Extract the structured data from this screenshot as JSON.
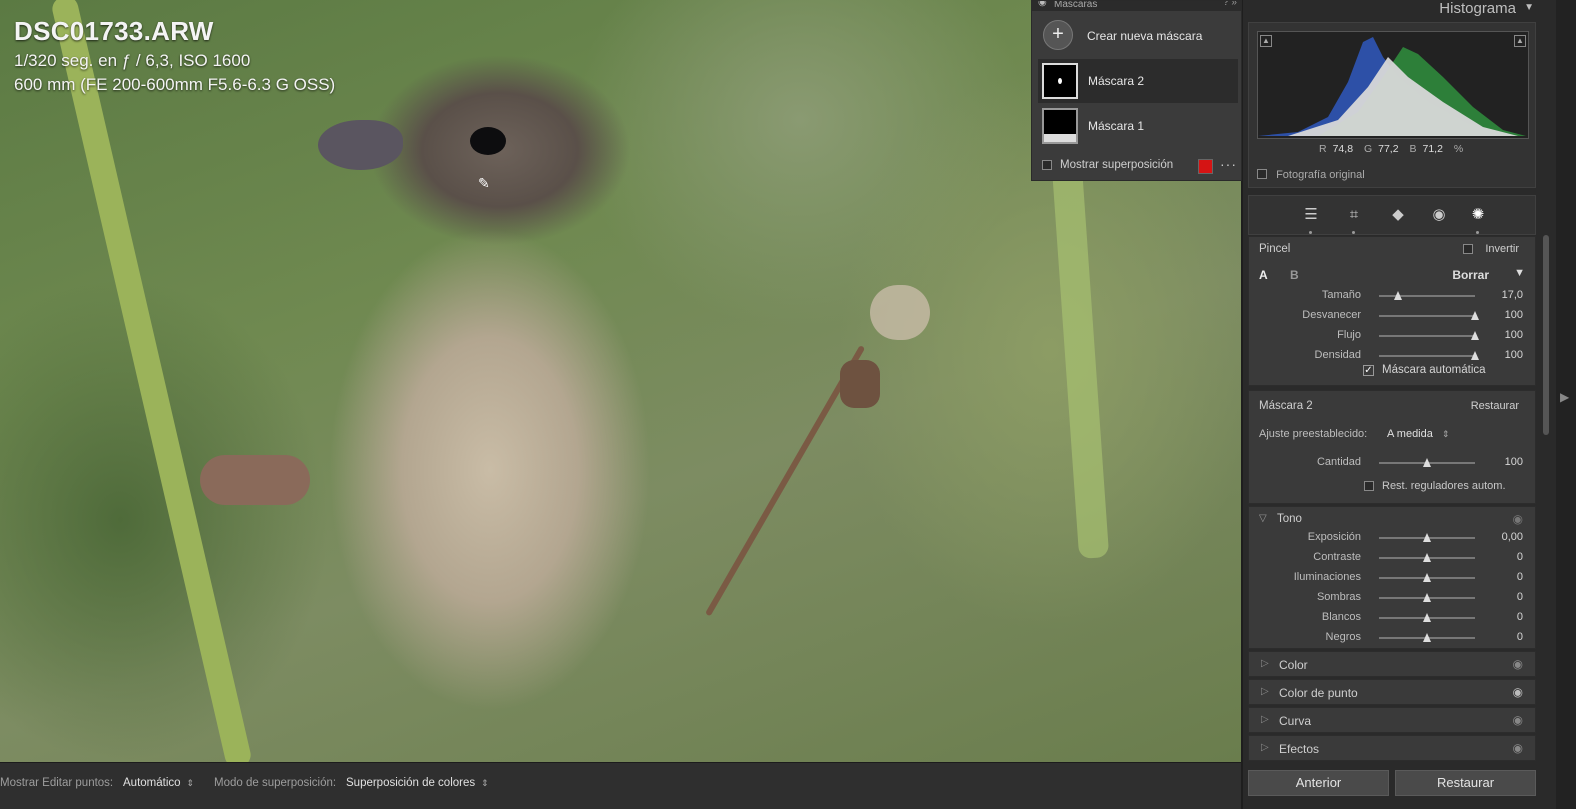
{
  "photo": {
    "filename": "DSC01733.ARW",
    "exposure_line": "1/320 seg. en ƒ / 6,3, ISO 1600",
    "lens_line": "600 mm (FE 200-600mm F5.6-6.3 G OSS)"
  },
  "masks_panel": {
    "title": "Máscaras",
    "create_label": "Crear nueva máscara",
    "items": [
      {
        "label": "Máscara 2",
        "selected": true
      },
      {
        "label": "Máscara 1",
        "selected": false
      }
    ],
    "show_overlay_label": "Mostrar superposición",
    "overlay_color": "#d51414"
  },
  "histogram": {
    "title": "Histograma",
    "r_label": "R",
    "r_value": "74,8",
    "g_label": "G",
    "g_value": "77,2",
    "b_label": "B",
    "b_value": "71,2",
    "unit": "%",
    "original_label": "Fotografía original"
  },
  "tools": [
    "sliders-icon",
    "crop-icon",
    "eraser-icon",
    "redeye-icon",
    "mask-icon"
  ],
  "brush": {
    "title": "Pincel",
    "invert_label": "Invertir",
    "tab_a": "A",
    "tab_b": "B",
    "mode_label": "Borrar",
    "sliders": [
      {
        "label": "Tamaño",
        "value": "17,0",
        "pos": 0.2
      },
      {
        "label": "Desvanecer",
        "value": "100",
        "pos": 1.0
      },
      {
        "label": "Flujo",
        "value": "100",
        "pos": 1.0
      },
      {
        "label": "Densidad",
        "value": "100",
        "pos": 1.0
      }
    ],
    "automask_label": "Máscara automática"
  },
  "mask_settings": {
    "title": "Máscara 2",
    "reset_label": "Restaurar",
    "preset_label": "Ajuste preestablecido:",
    "preset_value": "A medida",
    "amount_label": "Cantidad",
    "amount_value": "100",
    "amount_pos": 0.5,
    "auto_reset_label": "Rest. reguladores autom."
  },
  "tone": {
    "title": "Tono",
    "sliders": [
      {
        "label": "Exposición",
        "value": "0,00",
        "pos": 0.5
      },
      {
        "label": "Contraste",
        "value": "0",
        "pos": 0.5
      },
      {
        "label": "Iluminaciones",
        "value": "0",
        "pos": 0.5
      },
      {
        "label": "Sombras",
        "value": "0",
        "pos": 0.5
      },
      {
        "label": "Blancos",
        "value": "0",
        "pos": 0.5
      },
      {
        "label": "Negros",
        "value": "0",
        "pos": 0.5
      }
    ]
  },
  "collapsed_sections": [
    {
      "label": "Color"
    },
    {
      "label": "Color de punto"
    },
    {
      "label": "Curva"
    },
    {
      "label": "Efectos"
    }
  ],
  "buttons": {
    "previous": "Anterior",
    "reset": "Restaurar"
  },
  "toolbar": {
    "show_edit_points_label": "Mostrar Editar puntos:",
    "show_edit_points_value": "Automático",
    "overlay_mode_label": "Modo de superposición:",
    "overlay_mode_value": "Superposición de colores"
  }
}
